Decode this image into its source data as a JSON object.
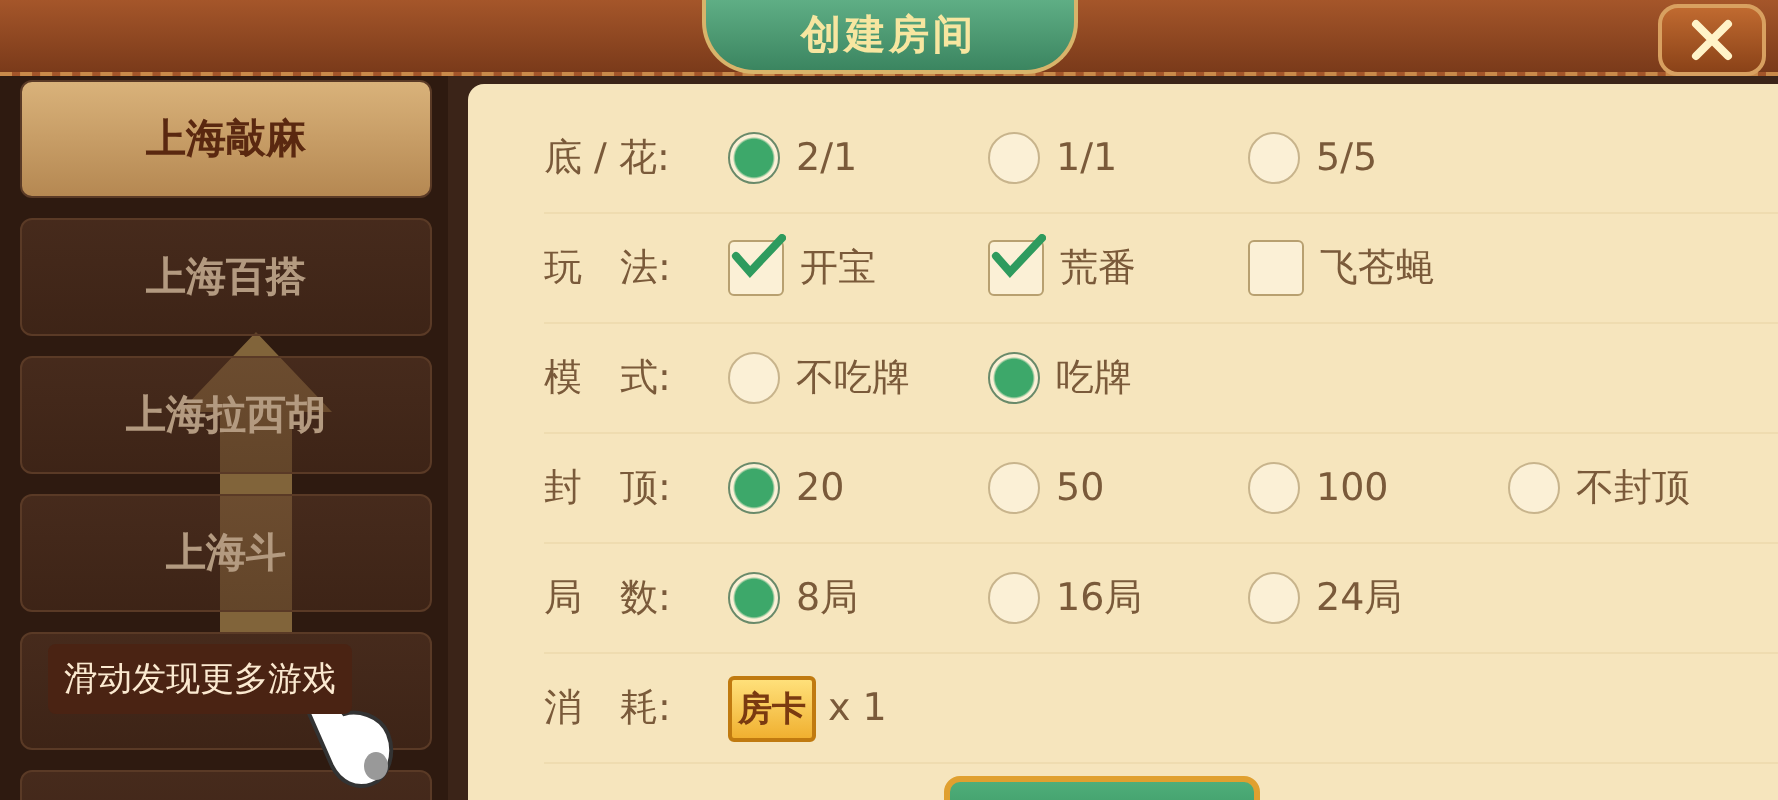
{
  "window": {
    "title": "创建房间"
  },
  "sidebar": {
    "items": [
      {
        "label": "上海敲麻",
        "selected": true
      },
      {
        "label": "上海百搭",
        "selected": false
      },
      {
        "label": "上海拉西胡",
        "selected": false
      },
      {
        "label": "上海斗",
        "selected": false
      },
      {
        "selected": false
      },
      {
        "selected": false
      }
    ],
    "hint": "滑动发现更多游戏"
  },
  "settings": [
    {
      "label": "底 / 花:",
      "kind": "radio",
      "options": [
        {
          "label": "2/1",
          "selected": true
        },
        {
          "label": "1/1",
          "selected": false
        },
        {
          "label": "5/5",
          "selected": false
        }
      ]
    },
    {
      "label": "玩　法:",
      "kind": "checkbox",
      "options": [
        {
          "label": "开宝",
          "checked": true
        },
        {
          "label": "荒番",
          "checked": true
        },
        {
          "label": "飞苍蝇",
          "checked": false
        }
      ]
    },
    {
      "label": "模　式:",
      "kind": "radio",
      "options": [
        {
          "label": "不吃牌",
          "selected": false
        },
        {
          "label": "吃牌",
          "selected": true
        }
      ]
    },
    {
      "label": "封　顶:",
      "kind": "radio",
      "options": [
        {
          "label": "20",
          "selected": true
        },
        {
          "label": "50",
          "selected": false
        },
        {
          "label": "100",
          "selected": false
        },
        {
          "label": "不封顶",
          "selected": false
        }
      ]
    },
    {
      "label": "局　数:",
      "kind": "radio",
      "options": [
        {
          "label": "8局",
          "selected": true
        },
        {
          "label": "16局",
          "selected": false
        },
        {
          "label": "24局",
          "selected": false
        }
      ]
    },
    {
      "label": "消　耗:",
      "kind": "cost",
      "card": "房卡",
      "amount": "x 1"
    }
  ]
}
